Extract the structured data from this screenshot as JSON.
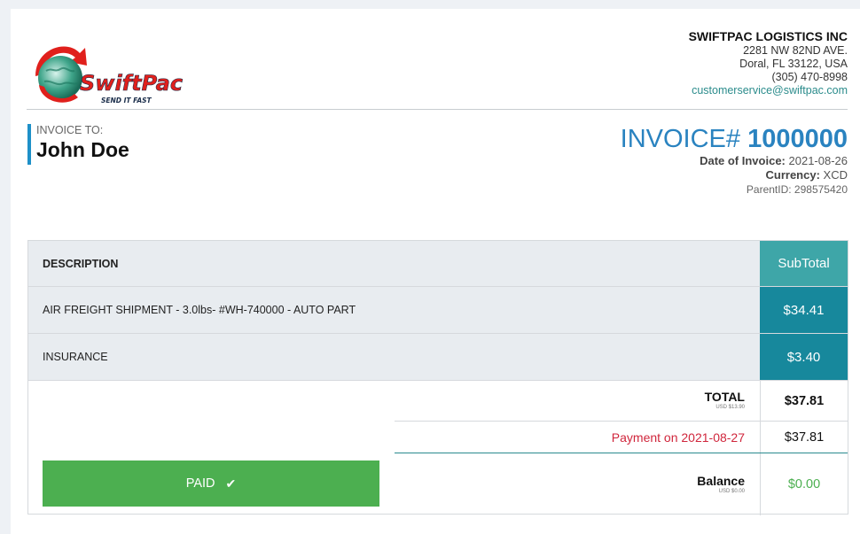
{
  "logo": {
    "brand": "SwiftPac",
    "tagline": "SEND IT FAST"
  },
  "company": {
    "name": "SWIFTPAC LOGISTICS INC",
    "address1": "2281 NW 82ND AVE.",
    "address2": "Doral, FL 33122, USA",
    "phone": "(305) 470-8998",
    "email": "customerservice@swiftpac.com"
  },
  "invoice_to": {
    "label": "INVOICE TO:",
    "name": "John Doe"
  },
  "invoice": {
    "prefix": "INVOICE#",
    "number": "1000000",
    "date_label": "Date of Invoice:",
    "date": "2021-08-26",
    "currency_label": "Currency:",
    "currency": "XCD",
    "parent": "ParentID: 298575420"
  },
  "table": {
    "col_description": "DESCRIPTION",
    "col_subtotal": "SubTotal",
    "items": [
      {
        "description": "AIR FREIGHT SHIPMENT - 3.0lbs- #WH-740000 - AUTO PART",
        "subtotal": "$34.41"
      },
      {
        "description": "INSURANCE",
        "subtotal": "$3.40"
      }
    ]
  },
  "summary": {
    "total_label": "TOTAL",
    "total_usd": "USD $13.90",
    "total_value": "$37.81",
    "payment_label": "Payment on 2021-08-27",
    "payment_value": "$37.81",
    "balance_label": "Balance",
    "balance_usd": "USD $0.00",
    "balance_value": "$0.00"
  },
  "status": {
    "label": "PAID",
    "icon": "check-icon"
  },
  "colors": {
    "accent_blue": "#2a83c0",
    "teal_header": "#3ea6a8",
    "teal_cell": "#17889c",
    "paid_green": "#4caf50",
    "payment_red": "#d0263c",
    "logo_red": "#e0201c"
  }
}
